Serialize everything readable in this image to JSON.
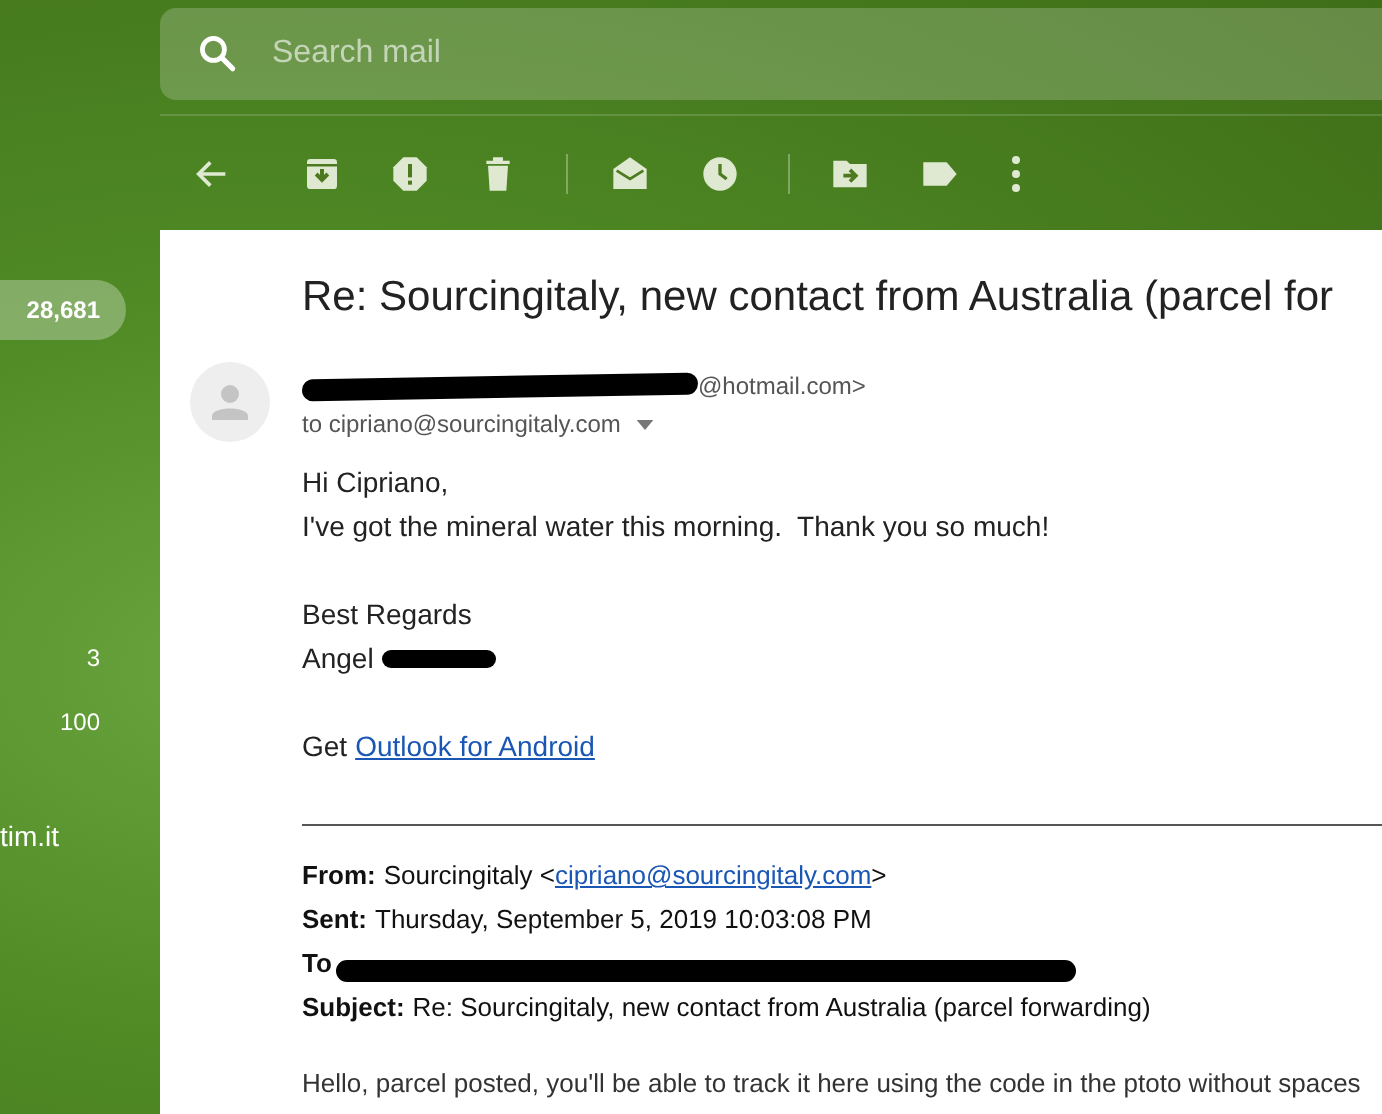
{
  "sidebar": {
    "counts": [
      {
        "text": "28,681",
        "selected": true
      },
      {
        "text": "3",
        "selected": false
      },
      {
        "text": "100",
        "selected": false
      }
    ],
    "account_fragment": "tim.it"
  },
  "search": {
    "placeholder": "Search mail"
  },
  "toolbar": [
    {
      "kind": "back"
    },
    {
      "kind": "archive"
    },
    {
      "kind": "spam"
    },
    {
      "kind": "delete"
    },
    {
      "kind": "separator"
    },
    {
      "kind": "mark_unread"
    },
    {
      "kind": "snooze"
    },
    {
      "kind": "separator"
    },
    {
      "kind": "move"
    },
    {
      "kind": "label"
    },
    {
      "kind": "more"
    }
  ],
  "message": {
    "subject": "Re: Sourcingitaly, new contact from Australia (parcel for",
    "sender_visible": "@hotmail.com>",
    "recipient": "to cipriano@sourcingitaly.com",
    "body": [
      {
        "kind": "text",
        "text": "Hi Cipriano,"
      },
      {
        "kind": "text",
        "text": "I've got the mineral water this morning.  Thank you so much!"
      },
      {
        "kind": "blank"
      },
      {
        "kind": "text",
        "text": "Best Regards"
      },
      {
        "kind": "redacted",
        "text": "Angel"
      },
      {
        "kind": "blank"
      },
      {
        "kind": "link",
        "text": "Get",
        "link": "Outlook for Android"
      }
    ],
    "quoted": {
      "from_label": "From:",
      "from_name": "Sourcingitaly <",
      "from_email": "cipriano@sourcingitaly.com",
      "from_end": ">",
      "sent_label": "Sent:",
      "sent_value": "Thursday, September 5, 2019 10:03:08 PM",
      "to_label": "To",
      "subject_label": "Subject:",
      "subject_value": "Re: Sourcingitaly, new contact from Australia (parcel forwarding)"
    },
    "reply_text": "Hello, parcel posted, you'll be able to track it here using the code in the ptoto without spaces"
  }
}
